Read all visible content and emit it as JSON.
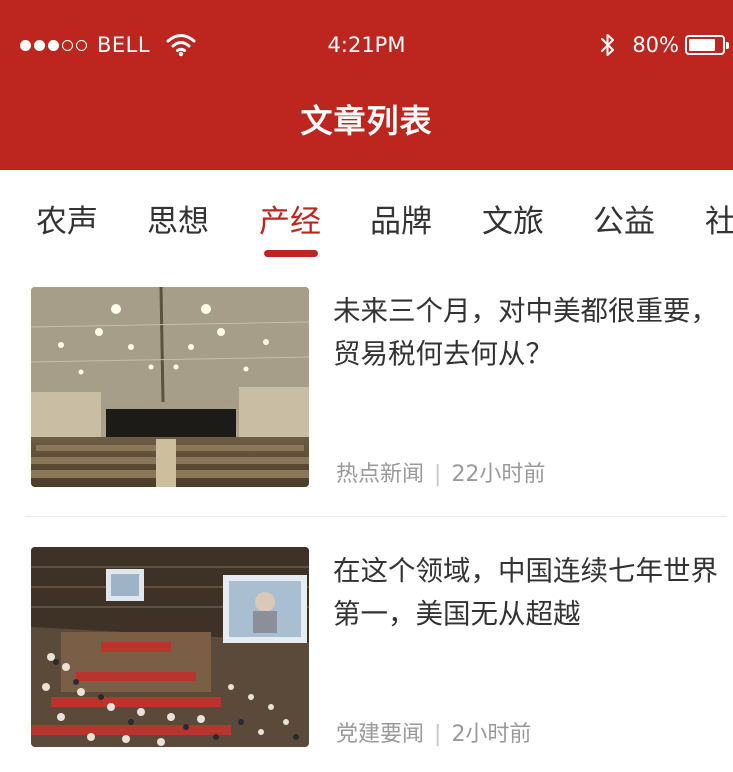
{
  "status_bar": {
    "carrier": "BELL",
    "time": "4:21PM",
    "battery_percent": "80%",
    "battery_level": 0.8,
    "signal_bars_filled": 3,
    "signal_bars_total": 5
  },
  "header": {
    "title": "文章列表"
  },
  "tabs": [
    {
      "label": "农声"
    },
    {
      "label": "思想"
    },
    {
      "label": "产经",
      "active": true
    },
    {
      "label": "品牌"
    },
    {
      "label": "文旅"
    },
    {
      "label": "公益"
    },
    {
      "label": "社"
    }
  ],
  "articles": [
    {
      "title": "未来三个月，对中美都很重要，贸易税何去何从？",
      "category": "热点新闻",
      "separator": "|",
      "time_ago": "22小时前",
      "image": "conference-hall-photo"
    },
    {
      "title": "在这个领域，中国连续七年世界第一，美国无从超越",
      "category": "党建要闻",
      "separator": "|",
      "time_ago": "2小时前",
      "image": "assembly-meeting-photo"
    }
  ],
  "colors": {
    "brand_red": "#bc261f",
    "text_primary": "#333333",
    "text_meta": "#9a9a9a"
  }
}
